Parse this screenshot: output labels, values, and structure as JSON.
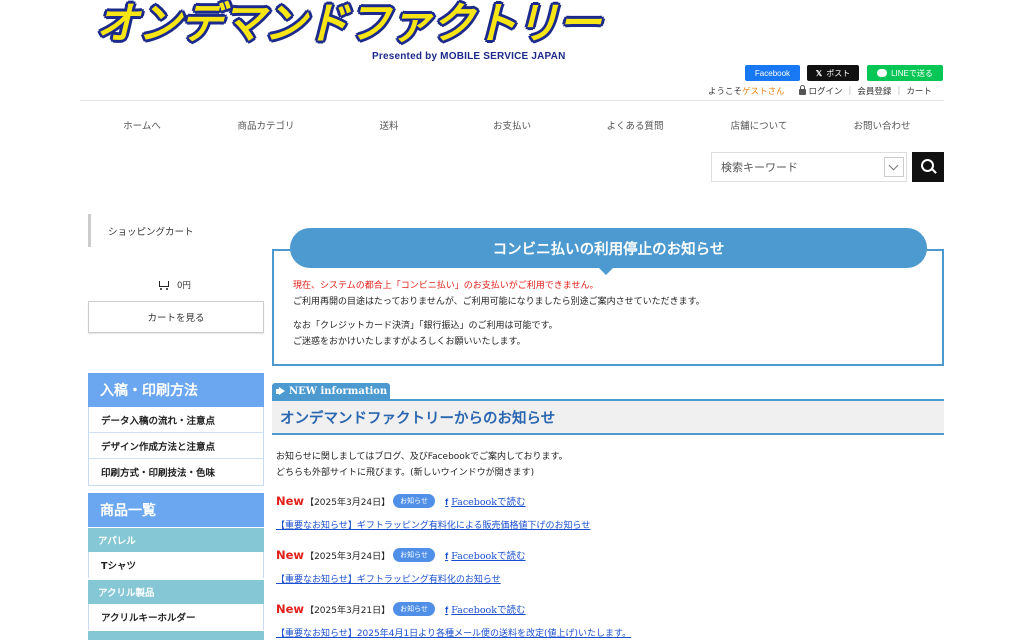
{
  "header": {
    "logo_text": "オンデマンドファクトリー",
    "logo_sub": "Presented by MOBILE SERVICE JAPAN",
    "social": {
      "facebook": "Facebook",
      "x_post": "ポスト",
      "line": "LINEで送る"
    },
    "user": {
      "welcome": "ようこそ",
      "guest": "ゲストさん",
      "login": "ログイン",
      "register": "会員登録",
      "cart": "カート"
    }
  },
  "nav": [
    "ホームへ",
    "商品カテゴリ",
    "送料",
    "お支払い",
    "よくある質問",
    "店舗について",
    "お問い合わせ"
  ],
  "search": {
    "placeholder": "検索キーワード"
  },
  "sidebar": {
    "cart_title": "ショッピングカート",
    "cart_amount": "0円",
    "cart_button": "カートを見る",
    "section1": {
      "title": "入稿・印刷方法",
      "items": [
        "データ入稿の流れ・注意点",
        "デザイン作成方法と注意点",
        "印刷方式・印刷技法・色味"
      ]
    },
    "section2": {
      "title": "商品一覧",
      "categories": [
        {
          "name": "アパレル",
          "item": "Tシャツ"
        },
        {
          "name": "アクリル製品",
          "item": "アクリルキーホルダー"
        }
      ]
    }
  },
  "notice": {
    "title": "コンビニ払いの利用停止のお知らせ",
    "line1": "現在、システムの都合上「コンビニ払い」のお支払いがご利用できません。",
    "line2": "ご利用再開の目途はたっておりませんが、ご利用可能になりましたら別途ご案内させていただきます。",
    "line3": "なお「クレジットカード決済」「銀行振込」のご利用は可能です。",
    "line4": "ご迷惑をおかけいたしますがよろしくお願いいたします。"
  },
  "news": {
    "tab": "NEW information",
    "heading": "オンデマンドファクトリーからのお知らせ",
    "intro1": "お知らせに関しましてはブログ、及びFacebookでご案内しております。",
    "intro2": "どちらも外部サイトに飛びます。(新しいウインドウが開きます)",
    "items": [
      {
        "new": "New",
        "date": "【2025年3月24日】",
        "badge": "お知らせ",
        "fb": "Facebookで読む",
        "link": "【重要なお知らせ】ギフトラッピング有料化による販売価格値下げのお知らせ"
      },
      {
        "new": "New",
        "date": "【2025年3月24日】",
        "badge": "お知らせ",
        "fb": "Facebookで読む",
        "link": "【重要なお知らせ】ギフトラッピング有料化のお知らせ"
      },
      {
        "new": "New",
        "date": "【2025年3月21日】",
        "badge": "お知らせ",
        "fb": "Facebookで読む",
        "link": "【重要なお知らせ】2025年4月1日より各種メール便の送料を改定(値上げ)いたします。"
      }
    ]
  }
}
